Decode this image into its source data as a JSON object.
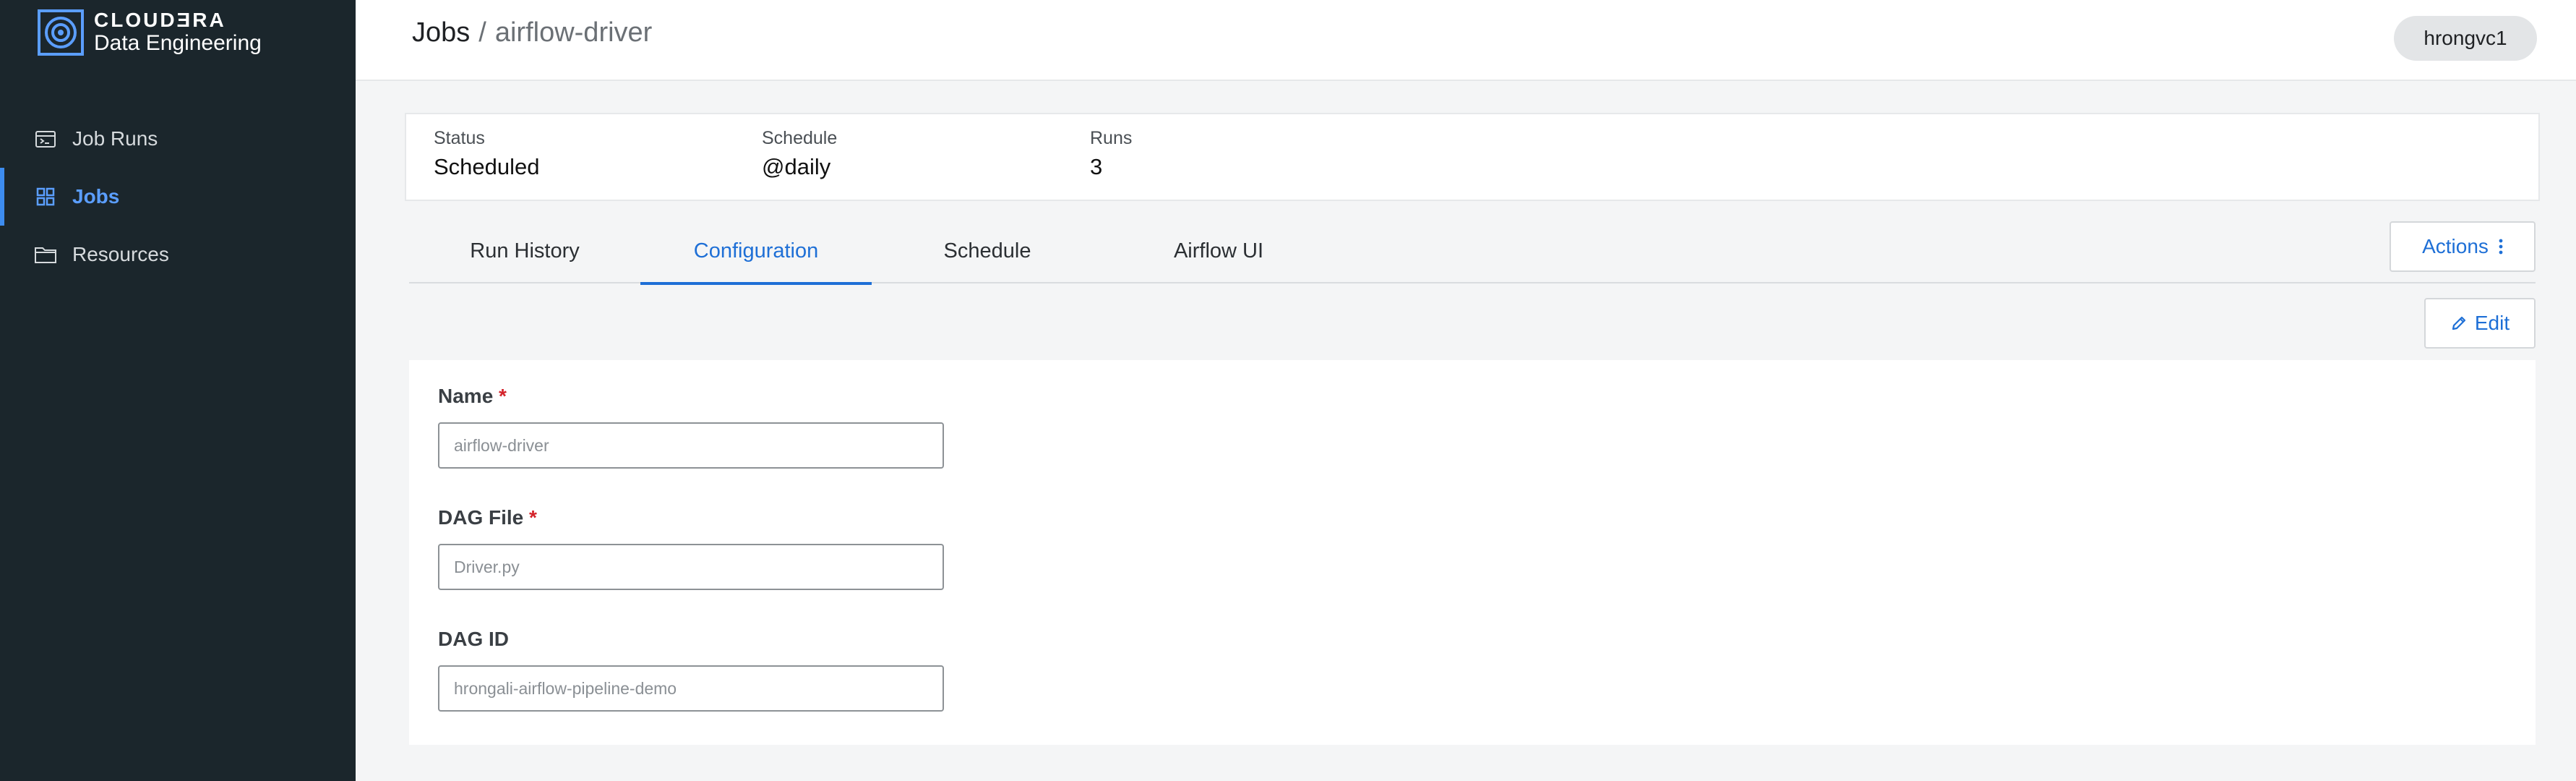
{
  "brand": {
    "name": "CLOUDƎRA",
    "subtitle": "Data Engineering",
    "icon": "cloudera-logo-icon"
  },
  "sidebar": {
    "items": [
      {
        "label": "Job Runs",
        "icon": "terminal-window-icon",
        "active": false
      },
      {
        "label": "Jobs",
        "icon": "grid-icon",
        "active": true
      },
      {
        "label": "Resources",
        "icon": "folder-icon",
        "active": false
      }
    ]
  },
  "header": {
    "breadcrumb_root": "Jobs",
    "breadcrumb_sep": "/",
    "breadcrumb_current": "airflow-driver",
    "user": "hrongvc1"
  },
  "summary": {
    "status": {
      "label": "Status",
      "value": "Scheduled"
    },
    "schedule": {
      "label": "Schedule",
      "value": "@daily"
    },
    "runs": {
      "label": "Runs",
      "value": "3"
    }
  },
  "tabs": [
    {
      "label": "Run History",
      "active": false
    },
    {
      "label": "Configuration",
      "active": true
    },
    {
      "label": "Schedule",
      "active": false
    },
    {
      "label": "Airflow UI",
      "active": false
    }
  ],
  "actions": {
    "label": "Actions",
    "icon": "kebab-vertical-icon"
  },
  "edit": {
    "label": "Edit",
    "icon": "pencil-icon"
  },
  "form": {
    "name": {
      "label": "Name",
      "required": "*",
      "placeholder": "airflow-driver"
    },
    "dag_file": {
      "label": "DAG File",
      "required": "*",
      "placeholder": "Driver.py"
    },
    "dag_id": {
      "label": "DAG ID",
      "placeholder": "hrongali-airflow-pipeline-demo"
    }
  },
  "colors": {
    "sidebar_bg": "#1b262c",
    "accent": "#1e6fd6",
    "active_nav": "#5b9eff",
    "required": "#d4232a"
  }
}
